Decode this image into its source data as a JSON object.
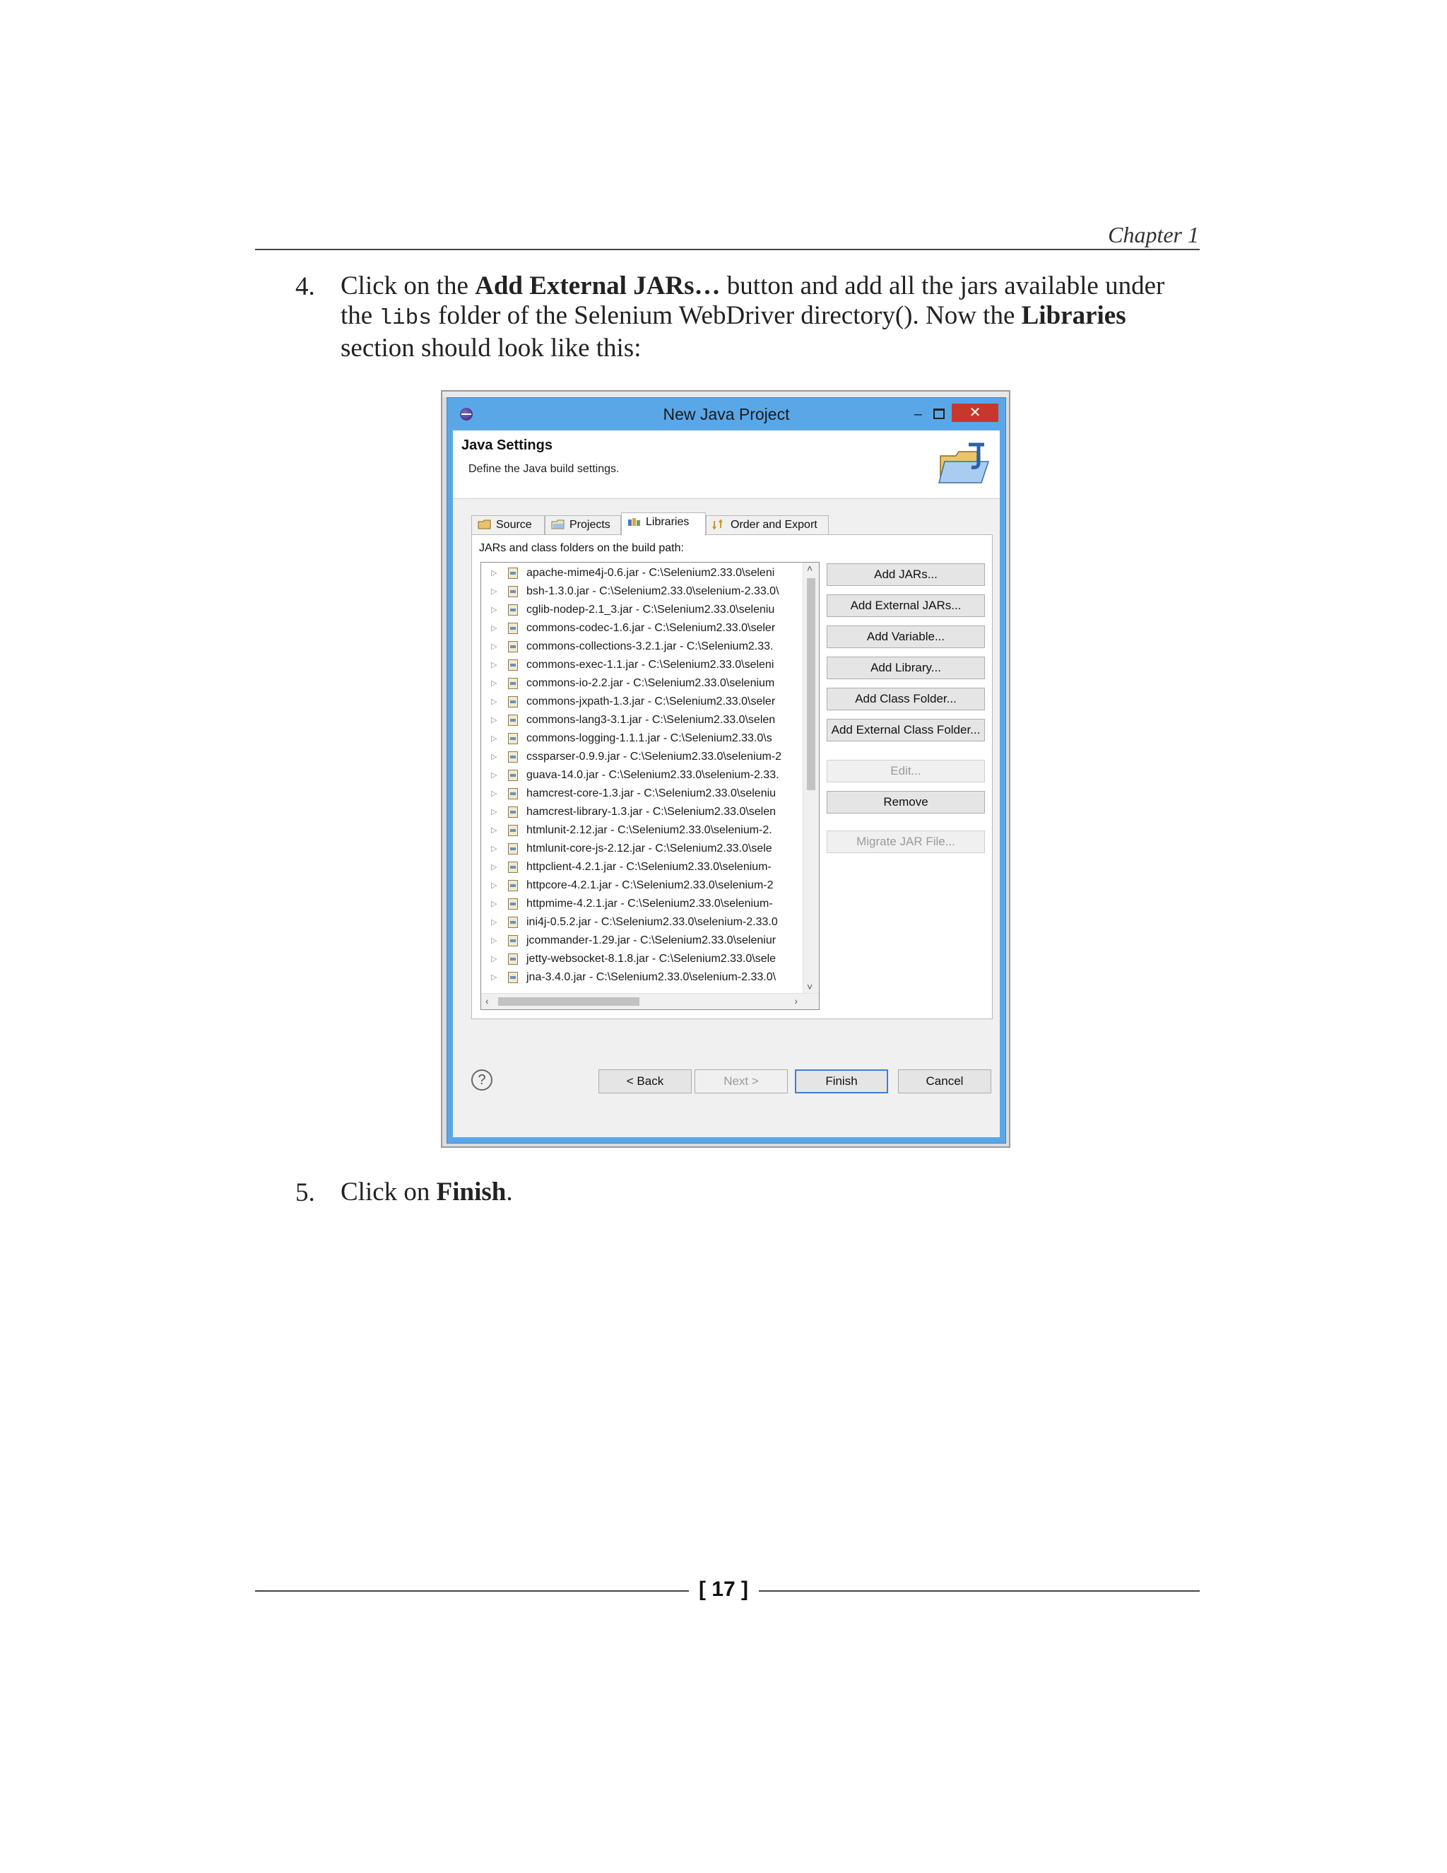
{
  "header": {
    "chapter": "Chapter 1"
  },
  "steps": [
    {
      "number": "4.",
      "line1_pre": "Click on the ",
      "line1_bold": "Add External JARs…",
      "line1_post": " button and add all the jars available under",
      "line2_pre": "the ",
      "line2_code": "libs",
      "line2_mid": " folder of the Selenium WebDriver directory(). Now the ",
      "line2_bold": "Libraries",
      "line3": "section should look like this:"
    },
    {
      "number": "5.",
      "pre": "Click on ",
      "bold": "Finish",
      "post": "."
    }
  ],
  "dialog": {
    "title": "New Java Project",
    "close_symbol": "✕",
    "min_symbol": "–",
    "banner_title": "Java Settings",
    "banner_subtitle": "Define the Java build settings.",
    "tabs": [
      "Source",
      "Projects",
      "Libraries",
      "Order and Export"
    ],
    "active_tab": "Libraries",
    "panel_label": "JARs and class folders on the build path:",
    "jars": [
      "apache-mime4j-0.6.jar - C:\\Selenium2.33.0\\seleni",
      "bsh-1.3.0.jar - C:\\Selenium2.33.0\\selenium-2.33.0\\",
      "cglib-nodep-2.1_3.jar - C:\\Selenium2.33.0\\seleniu",
      "commons-codec-1.6.jar - C:\\Selenium2.33.0\\seler",
      "commons-collections-3.2.1.jar - C:\\Selenium2.33.",
      "commons-exec-1.1.jar - C:\\Selenium2.33.0\\seleni",
      "commons-io-2.2.jar - C:\\Selenium2.33.0\\selenium",
      "commons-jxpath-1.3.jar - C:\\Selenium2.33.0\\seler",
      "commons-lang3-3.1.jar - C:\\Selenium2.33.0\\selen",
      "commons-logging-1.1.1.jar - C:\\Selenium2.33.0\\s",
      "cssparser-0.9.9.jar - C:\\Selenium2.33.0\\selenium-2",
      "guava-14.0.jar - C:\\Selenium2.33.0\\selenium-2.33.",
      "hamcrest-core-1.3.jar - C:\\Selenium2.33.0\\seleniu",
      "hamcrest-library-1.3.jar - C:\\Selenium2.33.0\\selen",
      "htmlunit-2.12.jar - C:\\Selenium2.33.0\\selenium-2.",
      "htmlunit-core-js-2.12.jar - C:\\Selenium2.33.0\\sele",
      "httpclient-4.2.1.jar - C:\\Selenium2.33.0\\selenium-",
      "httpcore-4.2.1.jar - C:\\Selenium2.33.0\\selenium-2",
      "httpmime-4.2.1.jar - C:\\Selenium2.33.0\\selenium-",
      "ini4j-0.5.2.jar - C:\\Selenium2.33.0\\selenium-2.33.0",
      "jcommander-1.29.jar - C:\\Selenium2.33.0\\seleniur",
      "jetty-websocket-8.1.8.jar - C:\\Selenium2.33.0\\sele",
      "jna-3.4.0.jar - C:\\Selenium2.33.0\\selenium-2.33.0\\"
    ],
    "side_buttons": {
      "add_jars": "Add JARs...",
      "add_external_jars": "Add External JARs...",
      "add_variable": "Add Variable...",
      "add_library": "Add Library...",
      "add_class_folder": "Add Class Folder...",
      "add_external_class_folder": "Add External Class Folder...",
      "edit": "Edit...",
      "remove": "Remove",
      "migrate_jar": "Migrate JAR File..."
    },
    "footer": {
      "help": "?",
      "back": "< Back",
      "next": "Next >",
      "finish": "Finish",
      "cancel": "Cancel"
    }
  },
  "page_number": "[ 17 ]",
  "colors": {
    "titlebar": "#5aa7e8",
    "close": "#c8372c",
    "default_border": "#3c7fd6"
  }
}
